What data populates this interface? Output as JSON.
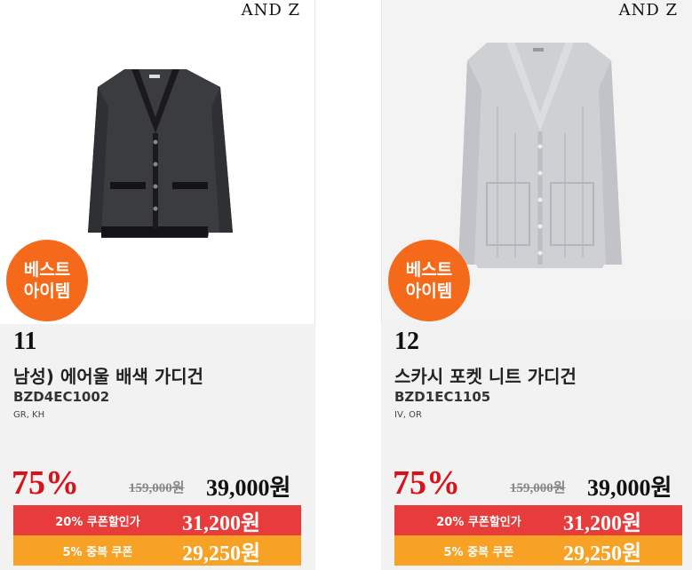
{
  "products": [
    {
      "brand": "AND Z",
      "badge_line1": "베스트",
      "badge_line2": "아이템",
      "rank": "11",
      "name": "남성) 에어울 배색 가디건",
      "code": "BZD4EC1002",
      "colors": "GR, KH",
      "discount": "75%",
      "original_price": "159,000원",
      "price": "39,000원",
      "coupon1_label": "20% 쿠폰할인가",
      "coupon1_price": "31,200원",
      "coupon2_label": "5% 중복 쿠폰",
      "coupon2_price": "29,250원"
    },
    {
      "brand": "AND Z",
      "badge_line1": "베스트",
      "badge_line2": "아이템",
      "rank": "12",
      "name": "스카시 포켓 니트 가디건",
      "code": "BZD1EC1105",
      "colors": "IV, OR",
      "discount": "75%",
      "original_price": "159,000원",
      "price": "39,000원",
      "coupon1_label": "20% 쿠폰할인가",
      "coupon1_price": "31,200원",
      "coupon2_label": "5% 중복 쿠폰",
      "coupon2_price": "29,250원"
    }
  ],
  "colors": {
    "badge": "#f46a1a",
    "discount": "#d8121b",
    "coupon1": "#e83c3c",
    "coupon2": "#f8a225"
  }
}
